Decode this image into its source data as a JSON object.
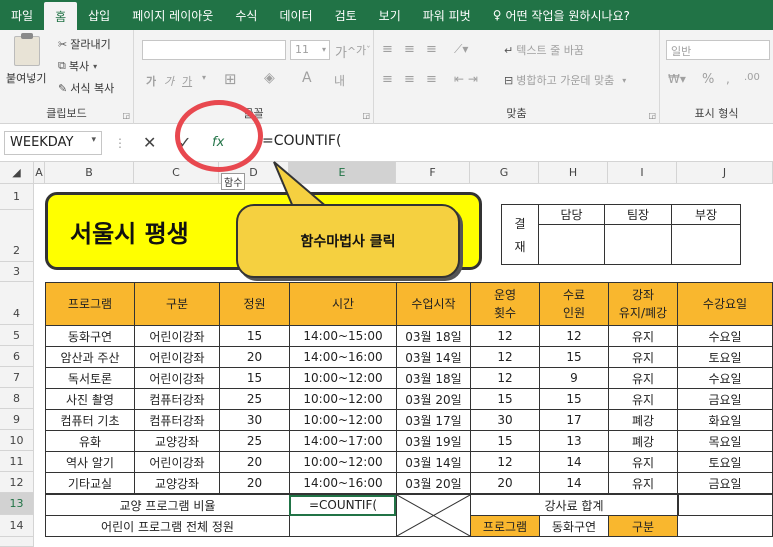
{
  "ribbon": {
    "tabs": [
      "파일",
      "홈",
      "삽입",
      "페이지 레이아웃",
      "수식",
      "데이터",
      "검토",
      "보기",
      "파워 피벗",
      "어떤 작업을 원하시나요?"
    ],
    "active_tab": "홈",
    "clipboard": {
      "paste": "붙여넣기",
      "cut": "잘라내기",
      "copy": "복사",
      "format_painter": "서식 복사",
      "label": "클립보드"
    },
    "font": {
      "size": "11",
      "bold": "가",
      "italic": "가",
      "underline": "가",
      "grow": "가",
      "shrink": "가",
      "group_label": "글꼴"
    },
    "alignment": {
      "wrap": "텍스트 줄 바꿈",
      "merge": "병합하고 가운데 맞춤",
      "label": "맞춤"
    },
    "number": {
      "format": "일반",
      "percent": "%",
      "label": "표시 형식"
    }
  },
  "formula_bar": {
    "name_box": "WEEKDAY",
    "cancel": "✕",
    "enter": "✓",
    "fx": "fx",
    "formula": "=COUNTIF(",
    "tooltip": "함수"
  },
  "grid": {
    "columns": [
      "A",
      "B",
      "C",
      "D",
      "E",
      "F",
      "G",
      "H",
      "I",
      "J"
    ],
    "rows": [
      "1",
      "2",
      "3",
      "4",
      "5",
      "6",
      "7",
      "8",
      "9",
      "10",
      "11",
      "12",
      "13",
      "14"
    ]
  },
  "title": "서울시 평생",
  "callout": "함수마법사  클릭",
  "approval": {
    "label1": "결",
    "label2": "재",
    "headers": [
      "담당",
      "팀장",
      "부장"
    ]
  },
  "table": {
    "headers": [
      "프로그램",
      "구분",
      "정원",
      "시간",
      "수업시작",
      "운영\n횟수",
      "수료\n인원",
      "강좌\n유지/폐강",
      "수강요일"
    ],
    "rows": [
      [
        "동화구연",
        "어린이강좌",
        "15",
        "14:00~15:00",
        "03월 18일",
        "12",
        "12",
        "유지",
        "수요일"
      ],
      [
        "암산과 주산",
        "어린이강좌",
        "20",
        "14:00~16:00",
        "03월 14일",
        "12",
        "15",
        "유지",
        "토요일"
      ],
      [
        "독서토론",
        "어린이강좌",
        "15",
        "10:00~12:00",
        "03월 18일",
        "12",
        "9",
        "유지",
        "수요일"
      ],
      [
        "사진 촬영",
        "컴퓨터강좌",
        "25",
        "10:00~12:00",
        "03월 20일",
        "15",
        "15",
        "유지",
        "금요일"
      ],
      [
        "컴퓨터 기초",
        "컴퓨터강좌",
        "30",
        "10:00~12:00",
        "03월 17일",
        "30",
        "17",
        "폐강",
        "화요일"
      ],
      [
        "유화",
        "교양강좌",
        "25",
        "14:00~17:00",
        "03월 19일",
        "15",
        "13",
        "폐강",
        "목요일"
      ],
      [
        "역사 알기",
        "어린이강좌",
        "20",
        "10:00~12:00",
        "03월 14일",
        "12",
        "14",
        "유지",
        "토요일"
      ],
      [
        "기타교실",
        "교양강좌",
        "20",
        "14:00~16:00",
        "03월 20일",
        "20",
        "14",
        "유지",
        "금요일"
      ]
    ],
    "summary": {
      "row13_label": "교양 프로그램 비율",
      "row13_value": "=COUNTIF(",
      "row13_right": "강사료 합계",
      "row14_label": "어린이 프로그램 전체 정원",
      "row14_g": "프로그램",
      "row14_h": "동화구연",
      "row14_i": "구분"
    }
  },
  "colors": {
    "excel_green": "#217346",
    "header_orange": "#f9b72e",
    "title_yellow": "#ffff00",
    "callout_gold": "#f5d040",
    "circle_red": "#e8484f"
  }
}
